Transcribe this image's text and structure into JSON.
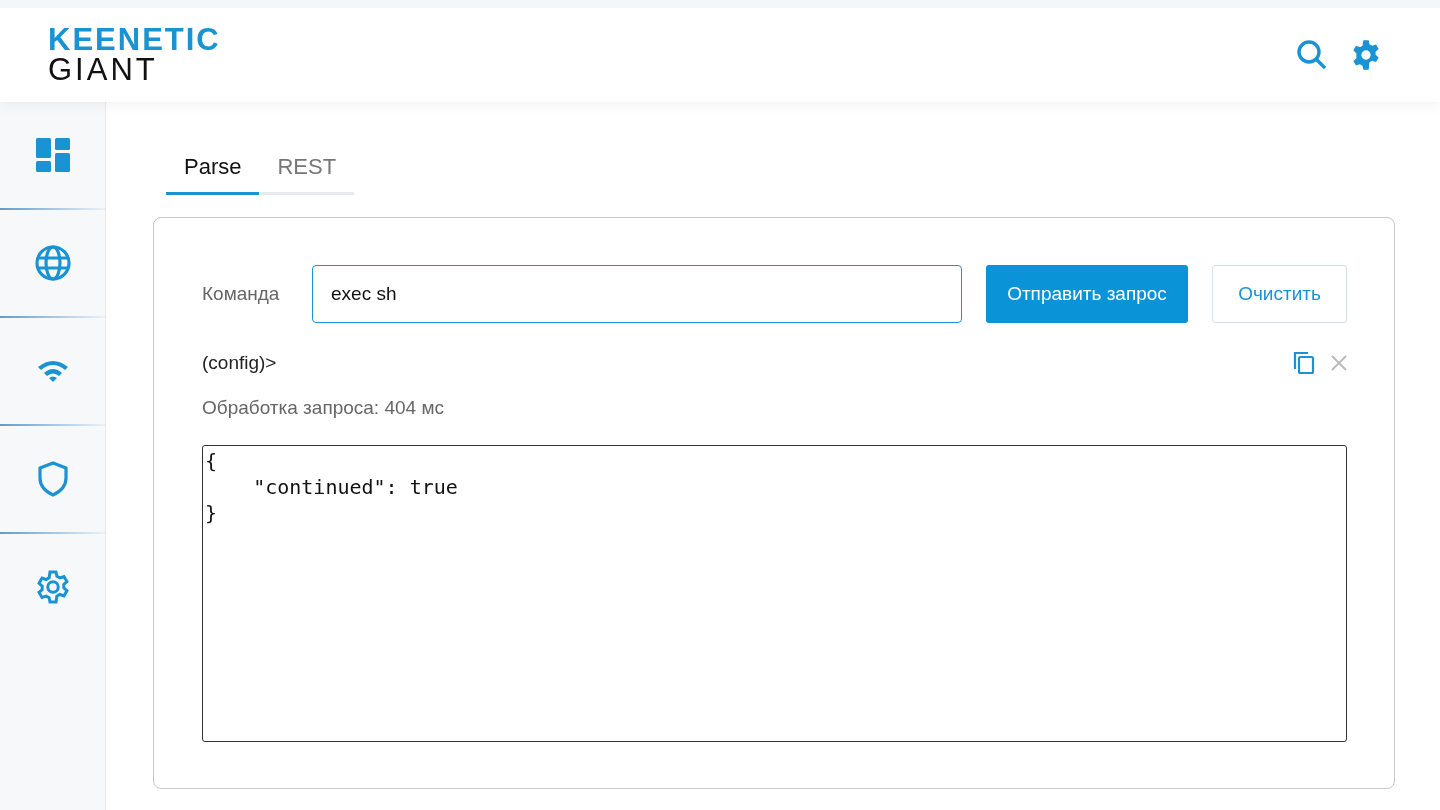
{
  "header": {
    "logo_brand": "KEENETIC",
    "logo_model": "GIANT"
  },
  "sidebar": {
    "items": [
      {
        "kind": "dashboard"
      },
      {
        "kind": "globe"
      },
      {
        "kind": "wifi"
      },
      {
        "kind": "shield"
      },
      {
        "kind": "settings"
      }
    ]
  },
  "tabs": [
    {
      "label": "Parse",
      "selected": true
    },
    {
      "label": "REST",
      "selected": false
    }
  ],
  "command": {
    "label": "Команда",
    "value": "exec sh"
  },
  "buttons": {
    "send": "Отправить запрос",
    "clear": "Очистить"
  },
  "prompt": "(config)>",
  "timing": "Обработка запроса: 404 мс",
  "response": "{\n    \"continued\": true\n}"
}
